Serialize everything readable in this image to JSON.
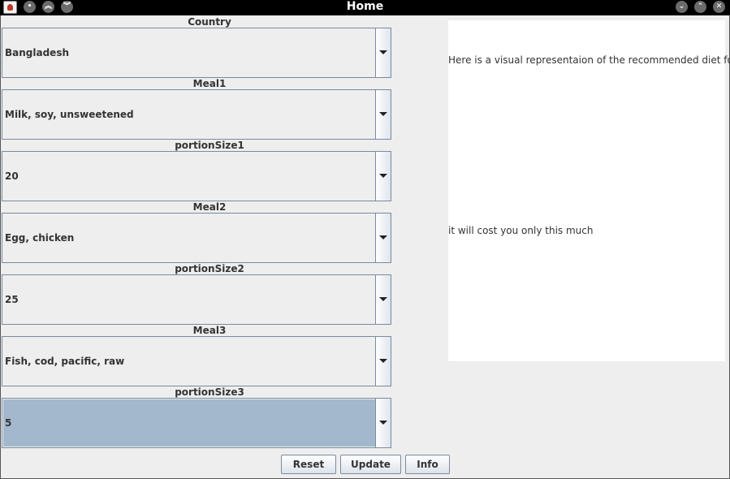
{
  "window": {
    "title": "Home",
    "controls_left": [
      "menu",
      "minimize",
      "maximize"
    ],
    "controls_right": [
      "minimize",
      "maximize",
      "close"
    ]
  },
  "form": {
    "fields": [
      {
        "label": "Country",
        "value": "Bangladesh"
      },
      {
        "label": "Meal1",
        "value": "Milk, soy, unsweetened"
      },
      {
        "label": "portionSize1",
        "value": "20"
      },
      {
        "label": "Meal2",
        "value": "Egg, chicken"
      },
      {
        "label": "portionSize2",
        "value": "25"
      },
      {
        "label": "Meal3",
        "value": "Fish, cod, pacific, raw"
      },
      {
        "label": "portionSize3",
        "value": "5",
        "selected": true
      }
    ]
  },
  "panel": {
    "visual_text": "Here is a visual representaion of the recommended diet for you",
    "cost_text": "it will cost you only this much"
  },
  "buttons": {
    "reset": "Reset",
    "update": "Update",
    "info": "Info"
  },
  "colors": {
    "selected_background": "#a3b8cc",
    "window_background": "#eeeeee",
    "title_bar": "#000000"
  }
}
